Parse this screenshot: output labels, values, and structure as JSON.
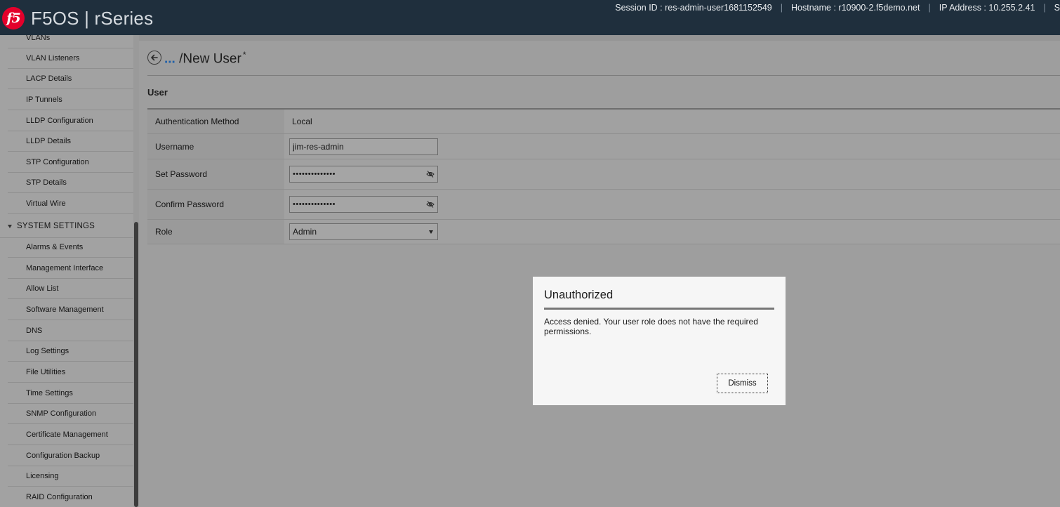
{
  "header": {
    "logo_text": "f5",
    "product_name": "F5OS | rSeries",
    "session_id": "Session ID : res-admin-user1681152549",
    "hostname": "Hostname : r10900-2.f5demo.net",
    "ip_address": "IP Address : 10.255.2.41",
    "overflow_text": "S"
  },
  "sidebar": {
    "clipped_item": "VLANs",
    "network_items": [
      "VLAN Listeners",
      "LACP Details",
      "IP Tunnels",
      "LLDP Configuration",
      "LLDP Details",
      "STP Configuration",
      "STP Details",
      "Virtual Wire"
    ],
    "section_label": "SYSTEM SETTINGS",
    "system_items": [
      "Alarms & Events",
      "Management Interface",
      "Allow List",
      "Software Management",
      "DNS",
      "Log Settings",
      "File Utilities",
      "Time Settings",
      "SNMP Configuration",
      "Certificate Management",
      "Configuration Backup",
      "Licensing",
      "RAID Configuration"
    ]
  },
  "page": {
    "breadcrumb_ellipsis": "...",
    "breadcrumb_title": "/New User",
    "modified_marker": "*",
    "section_title": "User"
  },
  "form": {
    "auth_method_label": "Authentication Method",
    "auth_method_value": "Local",
    "username_label": "Username",
    "username_value": "jim-res-admin",
    "set_password_label": "Set Password",
    "set_password_value": "••••••••••••••",
    "confirm_password_label": "Confirm Password",
    "confirm_password_value": "••••••••••••••",
    "role_label": "Role",
    "role_value": "Admin"
  },
  "modal": {
    "title": "Unauthorized",
    "message": "Access denied. Your user role does not have the required permissions.",
    "dismiss_label": "Dismiss"
  },
  "icons": {
    "back": "arrow-left-circle-icon",
    "password_toggle": "eye-off-icon",
    "section_toggle": "caret-down-icon",
    "select_arrow": "caret-down-icon"
  }
}
